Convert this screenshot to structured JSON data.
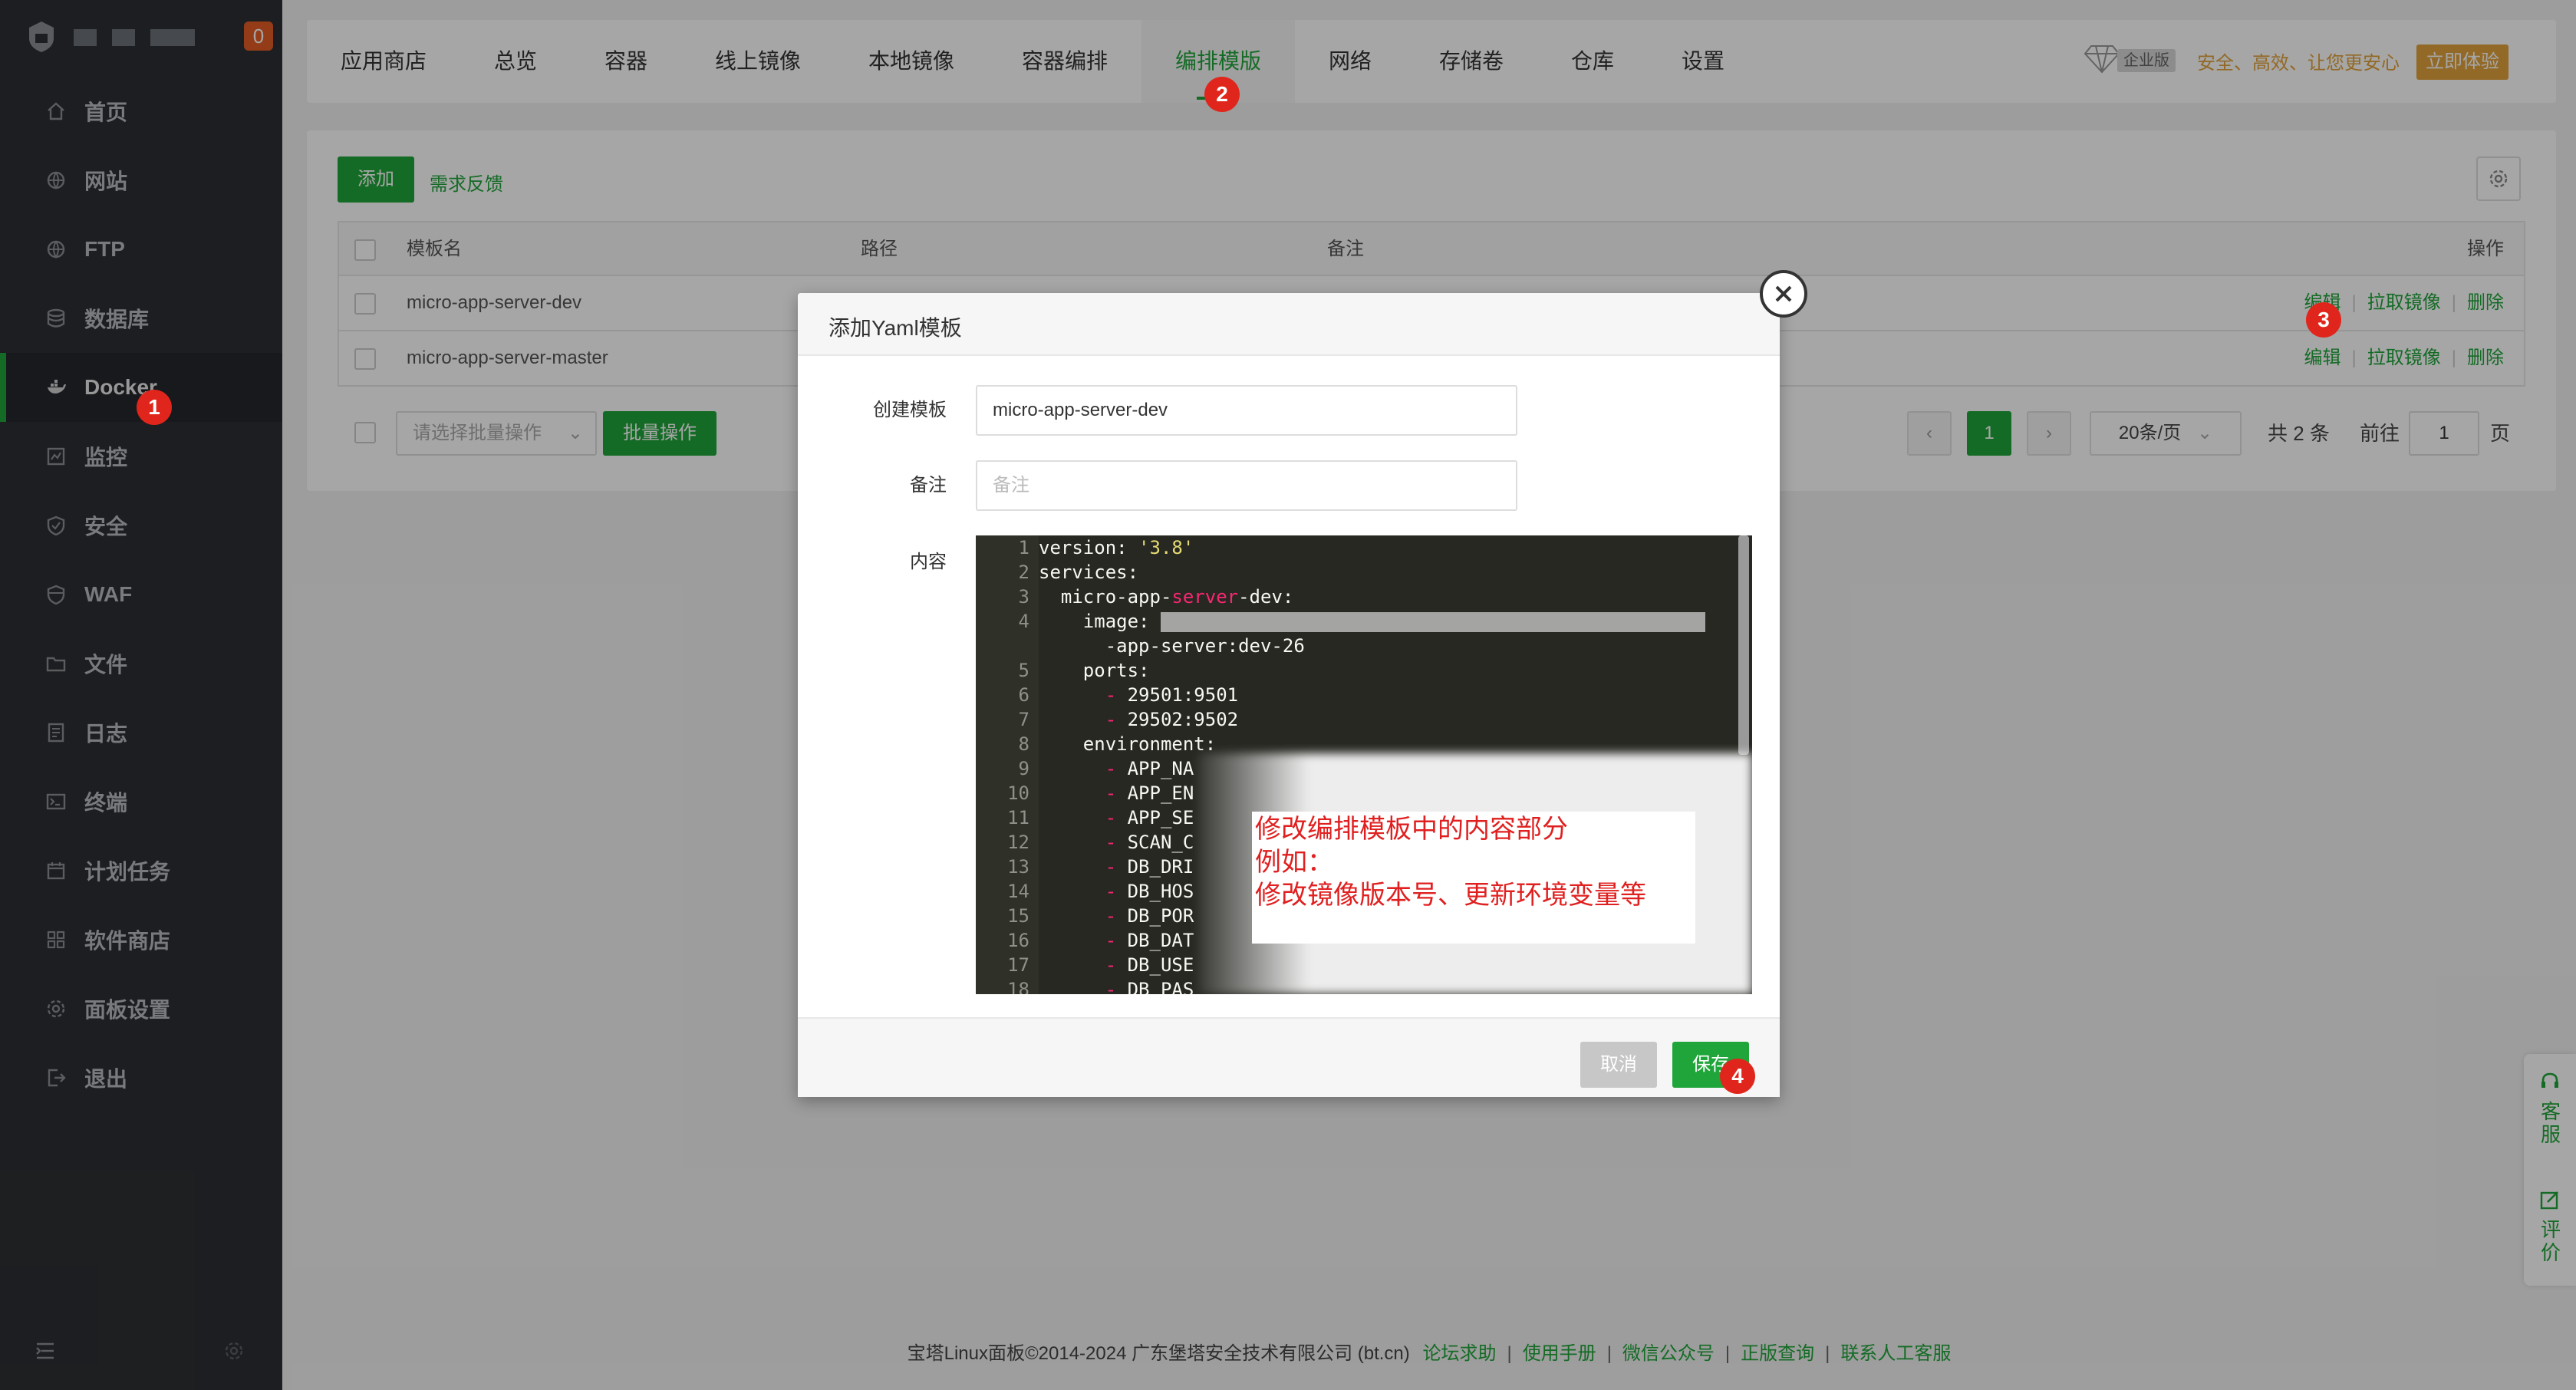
{
  "sidebar": {
    "badge": "0",
    "items": [
      {
        "label": "首页",
        "icon": "home-icon"
      },
      {
        "label": "网站",
        "icon": "globe-icon"
      },
      {
        "label": "FTP",
        "icon": "globe-icon"
      },
      {
        "label": "数据库",
        "icon": "database-icon"
      },
      {
        "label": "Docker",
        "icon": "docker-icon"
      },
      {
        "label": "监控",
        "icon": "monitor-icon"
      },
      {
        "label": "安全",
        "icon": "shield-icon"
      },
      {
        "label": "WAF",
        "icon": "shield-icon"
      },
      {
        "label": "文件",
        "icon": "folder-icon"
      },
      {
        "label": "日志",
        "icon": "log-icon"
      },
      {
        "label": "终端",
        "icon": "terminal-icon"
      },
      {
        "label": "计划任务",
        "icon": "calendar-icon"
      },
      {
        "label": "软件商店",
        "icon": "grid-icon"
      },
      {
        "label": "面板设置",
        "icon": "gear-icon"
      },
      {
        "label": "退出",
        "icon": "logout-icon"
      }
    ]
  },
  "topnav": {
    "tabs": [
      "应用商店",
      "总览",
      "容器",
      "线上镜像",
      "本地镜像",
      "容器编排",
      "编排模版",
      "网络",
      "存储卷",
      "仓库",
      "设置"
    ],
    "enterprise_tag": "企业版",
    "slogan": "安全、高效、让您更安心",
    "try_label": "立即体验"
  },
  "markers": [
    "1",
    "2",
    "3",
    "4"
  ],
  "panel": {
    "add_label": "添加",
    "feedback_label": "需求反馈",
    "columns": {
      "name": "模板名",
      "path": "路径",
      "remark": "备注",
      "ops": "操作"
    },
    "rows": [
      {
        "name": "micro-app-server-dev"
      },
      {
        "name": "micro-app-server-master"
      }
    ],
    "ops": {
      "edit": "编辑",
      "pull": "拉取镜像",
      "delete": "删除"
    },
    "batch_placeholder": "请选择批量操作",
    "batch_btn": "批量操作",
    "pager": {
      "prev": "‹",
      "page": "1",
      "next": "›",
      "per_page": "20条/页",
      "total": "共 2 条",
      "goto": "前往",
      "goto_value": "1",
      "page_unit": "页"
    }
  },
  "modal": {
    "title": "添加Yaml模板",
    "name_label": "创建模板",
    "name_value": "micro-app-server-dev",
    "remark_label": "备注",
    "remark_placeholder": "备注",
    "content_label": "内容",
    "code": {
      "l1_key": "version: ",
      "l1_val": "'3.8'",
      "l2": "services:",
      "l3_a": "  micro-app-",
      "l3_b": "server",
      "l3_c": "-dev:",
      "l4": "    image: ",
      "l4b": "      -app-server:dev-26",
      "l5": "    ports:",
      "l6_dash": "      - ",
      "l6": "29501:9501",
      "l7": "29502:9502",
      "l8": "    environment:",
      "envs": [
        "APP_NA",
        "APP_EN",
        "APP_SE",
        "SCAN_C",
        "DB_DRI",
        "DB_HOS",
        "DB_POR",
        "DB_DAT",
        "DB_USE",
        "DB_PAS"
      ]
    },
    "note_lines": [
      "修改编排模板中的内容部分",
      "例如：",
      "修改镜像版本号、更新环境变量等"
    ],
    "cancel_label": "取消",
    "save_label": "保存"
  },
  "float": {
    "service": "客服",
    "review": "评价"
  },
  "footer": {
    "copyright": "宝塔Linux面板©2014-2024 广东堡塔安全技术有限公司 (bt.cn)",
    "links": [
      "论坛求助",
      "使用手册",
      "微信公众号",
      "正版查询",
      "联系人工客服"
    ]
  }
}
